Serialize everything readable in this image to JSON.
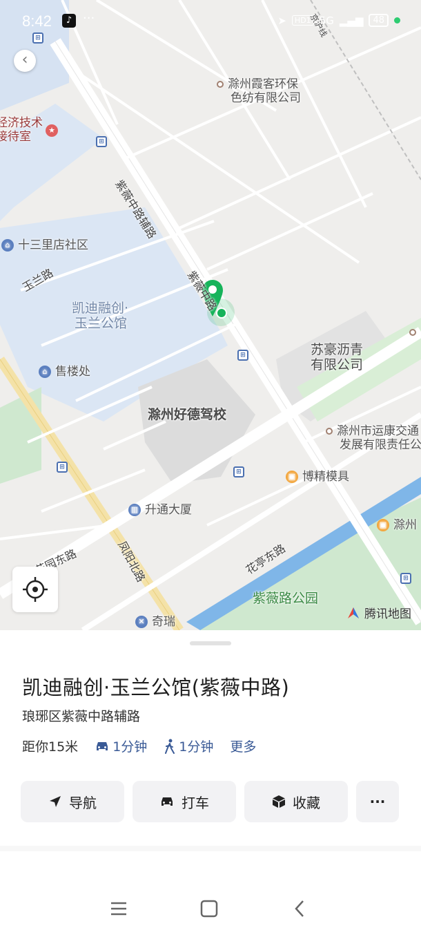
{
  "status_bar": {
    "time": "8:42",
    "more": "···",
    "network": "HD1",
    "signal": "5G",
    "battery": "48"
  },
  "map": {
    "labels": {
      "factory_a": "滁州霞客环保",
      "factory_a_2": "色纺有限公司",
      "tech_reception": "经济技术",
      "tech_reception_2": "接待室",
      "community": "十三里店社区",
      "yulan_road": "玉兰路",
      "estate": "凯迪融创·",
      "estate_2": "玉兰公馆",
      "sales_office": "售楼处",
      "driving_school": "滁州好德驾校",
      "suhao": "苏豪沥青",
      "suhao_2": "有限公司",
      "yunkang": "滁州市运康交通",
      "yunkang_2": "发展有限责任公",
      "bojing": "博精模具",
      "shengtong": "升通大厦",
      "chuzhou_right": "滁州",
      "fengyang_road": "凤阳北路",
      "huayuan_road": "花园东路",
      "huating_road": "花亭东路",
      "ziwei_park": "紫薇路公园",
      "qirui": "奇瑞",
      "ziwei_aux_road": "紫薇中路辅路",
      "ziwei_road_short": "紫薇中路",
      "railway": "京沪线"
    },
    "logo": "腾讯地图"
  },
  "place": {
    "title": "凯迪融创·玉兰公馆(紫薇中路)",
    "address": "琅琊区紫薇中路辅路",
    "distance": "距你15米",
    "drive_time": "1分钟",
    "walk_time": "1分钟",
    "more": "更多"
  },
  "actions": {
    "navigate": "导航",
    "taxi": "打车",
    "favorite": "收藏",
    "more": "···"
  },
  "colors": {
    "accent_green": "#16b35a",
    "link_blue": "#3a5a96",
    "water": "#7fb6e8",
    "park": "#cfe8cf",
    "residential": "#dbe6f4"
  }
}
